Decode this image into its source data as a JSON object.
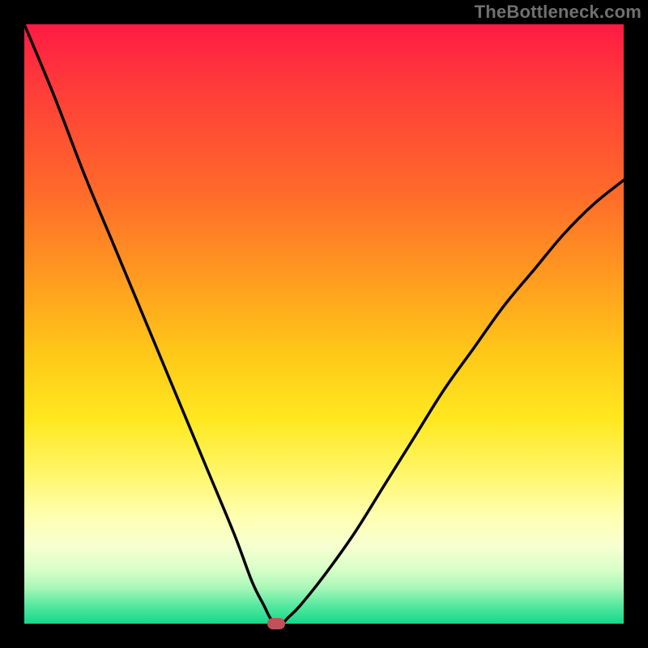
{
  "watermark": "TheBottleneck.com",
  "chart_data": {
    "type": "line",
    "title": "",
    "xlabel": "",
    "ylabel": "",
    "xlim": [
      0,
      100
    ],
    "ylim": [
      0,
      100
    ],
    "grid": false,
    "legend": false,
    "series": [
      {
        "name": "bottleneck-curve",
        "x": [
          0,
          5,
          10,
          15,
          20,
          25,
          30,
          35,
          38,
          40,
          41,
          42,
          43,
          44,
          46,
          50,
          55,
          60,
          65,
          70,
          75,
          80,
          85,
          90,
          95,
          100
        ],
        "y": [
          100,
          88,
          75,
          63,
          51,
          39,
          27,
          15,
          7,
          3,
          1,
          0,
          0,
          1,
          3,
          8,
          15,
          23,
          31,
          39,
          46,
          53,
          59,
          65,
          70,
          74
        ]
      }
    ],
    "marker": {
      "x": 42,
      "y": 0,
      "color": "#c0505a"
    },
    "background_gradient": {
      "top": "#ff1a44",
      "bottom": "#12d88a"
    }
  }
}
